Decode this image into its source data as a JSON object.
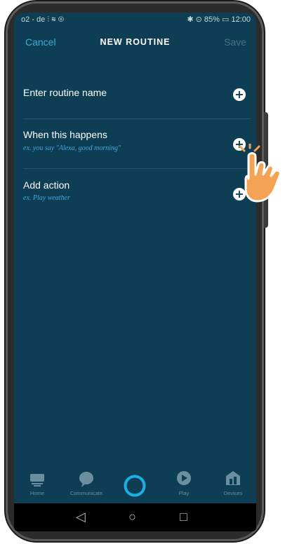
{
  "status_bar": {
    "carrier": "o2 - de",
    "battery": "85%",
    "time": "12:00"
  },
  "header": {
    "cancel_label": "Cancel",
    "title": "NEW ROUTINE",
    "save_label": "Save"
  },
  "rows": [
    {
      "label": "Enter routine name",
      "hint": ""
    },
    {
      "label": "When this happens",
      "hint": "ex. you say \"Alexa, good morning\""
    },
    {
      "label": "Add action",
      "hint": "ex. Play weather"
    }
  ],
  "bottom_nav": {
    "items": [
      {
        "label": "Home",
        "icon": "home-icon"
      },
      {
        "label": "Communicate",
        "icon": "chat-bubble-icon"
      },
      {
        "label": "",
        "icon": "alexa-ring-icon"
      },
      {
        "label": "Play",
        "icon": "play-icon"
      },
      {
        "label": "Devices",
        "icon": "devices-icon"
      }
    ]
  },
  "colors": {
    "background": "#0d3e53",
    "accent": "#3fa9de",
    "pointer": "#f3a353"
  }
}
